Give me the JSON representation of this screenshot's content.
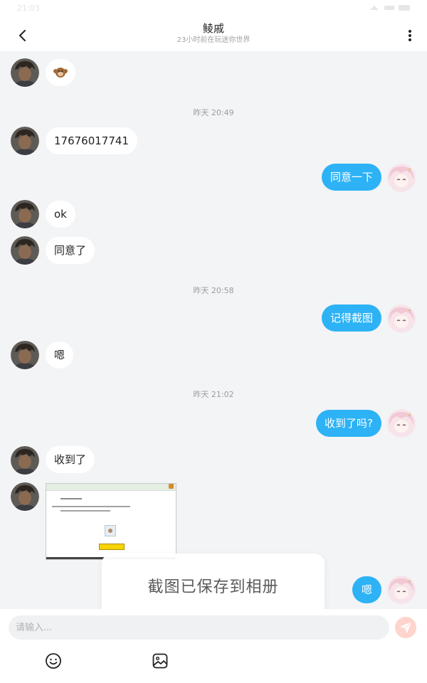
{
  "status_bar": {
    "time": "21:03"
  },
  "header": {
    "title": "鲮戚",
    "subtitle": "23小时前在玩迷你世界"
  },
  "messages": [
    {
      "side": "left",
      "type": "sticker",
      "icon": "monkey-emoji-icon"
    },
    {
      "type": "timestamp",
      "text": "昨天 20:49"
    },
    {
      "side": "left",
      "type": "text",
      "text": "17676017741"
    },
    {
      "side": "right",
      "type": "text",
      "text": "同意一下"
    },
    {
      "side": "left",
      "type": "text",
      "text": "ok"
    },
    {
      "side": "left",
      "type": "text",
      "text": "同意了"
    },
    {
      "type": "timestamp",
      "text": "昨天 20:58"
    },
    {
      "side": "right",
      "type": "text",
      "text": "记得截图"
    },
    {
      "side": "left",
      "type": "text",
      "text": "嗯"
    },
    {
      "type": "timestamp",
      "text": "昨天 21:02"
    },
    {
      "side": "right",
      "type": "text",
      "text": "收到了吗?"
    },
    {
      "side": "left",
      "type": "text",
      "text": "收到了"
    },
    {
      "side": "left",
      "type": "image",
      "description_icon": "screenshot-thumbnail"
    },
    {
      "side": "right",
      "type": "text",
      "text": "嗯"
    }
  ],
  "toast": {
    "text": "截图已保存到相册"
  },
  "input": {
    "placeholder": "请输入..."
  },
  "colors": {
    "outgoing_bubble": "#2db2f6",
    "incoming_bubble": "#ffffff",
    "background": "#f3f4f6",
    "send_button": "#ffd4cc"
  }
}
